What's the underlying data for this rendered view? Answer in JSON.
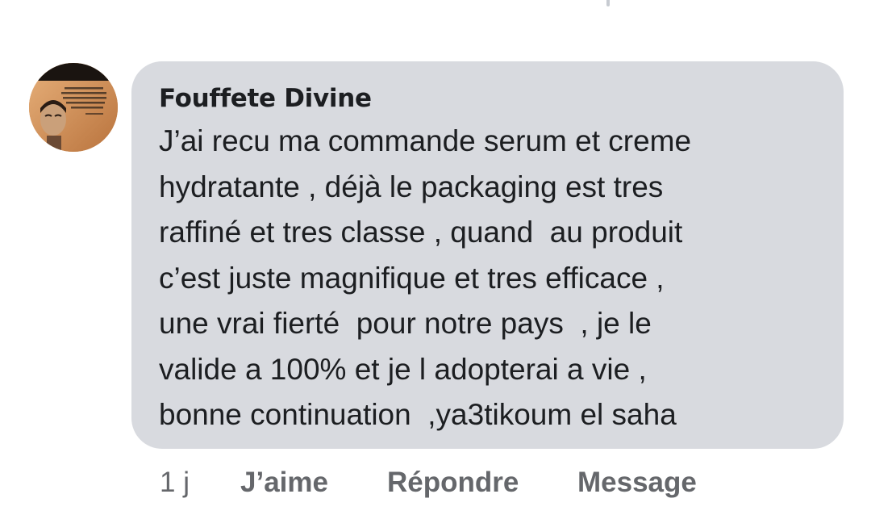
{
  "comment": {
    "author": "Fouffete Divine",
    "text_lines": [
      "J’ai recu ma commande serum et creme",
      "hydratante , déjà le packaging est tres",
      "raffiné et tres classe , quand  au produit",
      "c’est juste magnifique et tres efficace ,",
      "une vrai fierté  pour notre pays  , je le",
      "valide a 100% et je l adopterai a vie ,",
      "bonne continuation  ,ya3tikoum el saha"
    ],
    "avatar_icon": "profile-photo-avatar",
    "bubble_color": "#d8dadf"
  },
  "actions": {
    "timestamp": "1 j",
    "like_label": "J’aime",
    "reply_label": "Répondre",
    "message_label": "Message",
    "color": "#65676b"
  }
}
